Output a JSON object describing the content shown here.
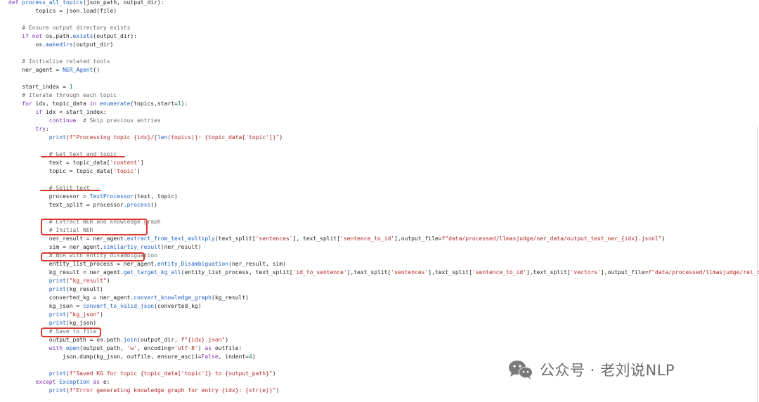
{
  "code": {
    "lines": [
      [
        [
          "kw",
          "def "
        ],
        [
          "fn",
          "process_all_topics"
        ],
        [
          "tx",
          "(json_path, output_dir):"
        ]
      ],
      [
        [
          "tx",
          "        topics = json.load(file)"
        ]
      ],
      [
        [
          "tx",
          ""
        ]
      ],
      [
        [
          "cm",
          "    # Ensure output directory exists"
        ]
      ],
      [
        [
          "kw",
          "    if not "
        ],
        [
          "tx",
          "os.path."
        ],
        [
          "fn",
          "exists"
        ],
        [
          "tx",
          "(output_dir):"
        ]
      ],
      [
        [
          "tx",
          "        os."
        ],
        [
          "fn",
          "makedirs"
        ],
        [
          "tx",
          "(output_dir)"
        ]
      ],
      [
        [
          "tx",
          ""
        ]
      ],
      [
        [
          "cm",
          "    # Initialize related tools"
        ]
      ],
      [
        [
          "tx",
          "    ner_agent = "
        ],
        [
          "fn",
          "NER_Agent"
        ],
        [
          "tx",
          "()"
        ]
      ],
      [
        [
          "tx",
          ""
        ]
      ],
      [
        [
          "tx",
          "    start_index = "
        ],
        [
          "num",
          "1"
        ]
      ],
      [
        [
          "cm",
          "    # Iterate through each topic"
        ]
      ],
      [
        [
          "kw",
          "    for "
        ],
        [
          "tx",
          "idx, topic_data "
        ],
        [
          "kw",
          "in "
        ],
        [
          "bi",
          "enumerate"
        ],
        [
          "tx",
          "(topics,start="
        ],
        [
          "num",
          "1"
        ],
        [
          "tx",
          "):"
        ]
      ],
      [
        [
          "kw",
          "        if "
        ],
        [
          "tx",
          "idx < start_index:"
        ]
      ],
      [
        [
          "kw",
          "            continue  "
        ],
        [
          "cm",
          "# Skip previous entries"
        ]
      ],
      [
        [
          "kw",
          "        try"
        ],
        [
          "tx",
          ":"
        ]
      ],
      [
        [
          "bi",
          "            print"
        ],
        [
          "tx",
          "("
        ],
        [
          "str",
          "f\"Processing topic {idx}/{"
        ],
        [
          "bi",
          "len"
        ],
        [
          "str",
          "(topics)}: {topic_data['topic']}\""
        ],
        [
          "tx",
          ")"
        ]
      ],
      [
        [
          "tx",
          ""
        ]
      ],
      [
        [
          "cm",
          "            # Get text and topic"
        ]
      ],
      [
        [
          "tx",
          "            text = topic_data["
        ],
        [
          "str",
          "'content'"
        ],
        [
          "tx",
          "]"
        ]
      ],
      [
        [
          "tx",
          "            topic = topic_data["
        ],
        [
          "str",
          "'topic'"
        ],
        [
          "tx",
          "]"
        ]
      ],
      [
        [
          "tx",
          ""
        ]
      ],
      [
        [
          "cm",
          "            # Split text"
        ]
      ],
      [
        [
          "tx",
          "            processor = "
        ],
        [
          "fn",
          "TextProcessor"
        ],
        [
          "tx",
          "(text, topic)"
        ]
      ],
      [
        [
          "tx",
          "            text_split = processor."
        ],
        [
          "fn",
          "process"
        ],
        [
          "tx",
          "()"
        ]
      ],
      [
        [
          "tx",
          ""
        ]
      ],
      [
        [
          "cm",
          "            # Extract NER and knowledge graph"
        ]
      ],
      [
        [
          "cm",
          "            # Initial NER"
        ]
      ],
      [
        [
          "tx",
          "            ner_result = ner_agent."
        ],
        [
          "fn",
          "extract_from_text_multiply"
        ],
        [
          "tx",
          "(text_split["
        ],
        [
          "str",
          "'sentences'"
        ],
        [
          "tx",
          "], text_split["
        ],
        [
          "str",
          "'sentence_to_id'"
        ],
        [
          "tx",
          "],output_file="
        ],
        [
          "str",
          "f\"data/processed/llmasjudge/ner_data/output_text_ner_{idx}.jsonl\""
        ],
        [
          "tx",
          ")"
        ]
      ],
      [
        [
          "tx",
          "            sim = ner_agent."
        ],
        [
          "fn",
          "similartiy_result"
        ],
        [
          "tx",
          "(ner_result)"
        ]
      ],
      [
        [
          "cm",
          "            # NER with entity disambiguation"
        ]
      ],
      [
        [
          "tx",
          "            entity_list_process = ner_agent."
        ],
        [
          "fn",
          "entity_Disambiguation"
        ],
        [
          "tx",
          "(ner_result, sim)"
        ]
      ],
      [
        [
          "tx",
          "            kg_result = ner_agent."
        ],
        [
          "fn",
          "get_target_kg_all"
        ],
        [
          "tx",
          "(entity_list_process, text_split["
        ],
        [
          "str",
          "'id_to_sentence'"
        ],
        [
          "tx",
          "],text_split["
        ],
        [
          "str",
          "'sentences'"
        ],
        [
          "tx",
          "],text_split["
        ],
        [
          "str",
          "'sentence_to_id'"
        ],
        [
          "tx",
          "],text_split["
        ],
        [
          "str",
          "'vectors'"
        ],
        [
          "tx",
          "],output_file="
        ],
        [
          "str",
          "f\"data/processed/llmasjudge/rel_data/output_kg_{idx}.json\""
        ],
        [
          "tx",
          ")"
        ]
      ],
      [
        [
          "bi",
          "            print"
        ],
        [
          "tx",
          "("
        ],
        [
          "str",
          "\"kg_result\""
        ],
        [
          "tx",
          ")"
        ]
      ],
      [
        [
          "bi",
          "            print"
        ],
        [
          "tx",
          "(kg_result)"
        ]
      ],
      [
        [
          "tx",
          "            converted_kg = ner_agent."
        ],
        [
          "fn",
          "convert_knowledge_graph"
        ],
        [
          "tx",
          "(kg_result)"
        ]
      ],
      [
        [
          "tx",
          "            kg_json = "
        ],
        [
          "fn",
          "convert_to_valid_json"
        ],
        [
          "tx",
          "(converted_kg)"
        ]
      ],
      [
        [
          "bi",
          "            print"
        ],
        [
          "tx",
          "("
        ],
        [
          "str",
          "\"kg_json\""
        ],
        [
          "tx",
          ")"
        ]
      ],
      [
        [
          "bi",
          "            print"
        ],
        [
          "tx",
          "(kg_json)"
        ]
      ],
      [
        [
          "cm",
          "            # Save to file"
        ]
      ],
      [
        [
          "tx",
          "            output_path = os.path."
        ],
        [
          "fn",
          "join"
        ],
        [
          "tx",
          "(output_dir, "
        ],
        [
          "str",
          "f\"{idx}.json\""
        ],
        [
          "tx",
          ")"
        ]
      ],
      [
        [
          "kw",
          "            with "
        ],
        [
          "bi",
          "open"
        ],
        [
          "tx",
          "(output_path, "
        ],
        [
          "str",
          "'w'"
        ],
        [
          "tx",
          ", encoding="
        ],
        [
          "str",
          "'utf-8'"
        ],
        [
          "tx",
          ") "
        ],
        [
          "kw",
          "as "
        ],
        [
          "tx",
          "outfile:"
        ]
      ],
      [
        [
          "tx",
          "                json.dump(kg_json, outfile, ensure_ascii="
        ],
        [
          "kw",
          "False"
        ],
        [
          "tx",
          ", indent="
        ],
        [
          "num",
          "4"
        ],
        [
          "tx",
          ")"
        ]
      ],
      [
        [
          "tx",
          ""
        ]
      ],
      [
        [
          "bi",
          "            print"
        ],
        [
          "tx",
          "("
        ],
        [
          "str",
          "f\"Saved KG for topic {topic_data['topic']} to {output_path}\""
        ],
        [
          "tx",
          ")"
        ]
      ],
      [
        [
          "kw",
          "        except "
        ],
        [
          "fn",
          "Exception "
        ],
        [
          "kw",
          "as "
        ],
        [
          "tx",
          "e:"
        ]
      ],
      [
        [
          "bi",
          "            print"
        ],
        [
          "tx",
          "("
        ],
        [
          "str",
          "f\"Error generating knowledge graph for entry {idx}: {str(e)}\""
        ],
        [
          "tx",
          ")"
        ]
      ]
    ]
  },
  "watermark": {
    "text": "公众号 · 老刘说NLP",
    "logo_icon": "wechat-icon"
  },
  "colors": {
    "annotation": "#d93a2b",
    "keyword": "#7b2fb5",
    "function": "#1c5fc4",
    "string": "#b32424",
    "comment": "#6a6a6a"
  }
}
